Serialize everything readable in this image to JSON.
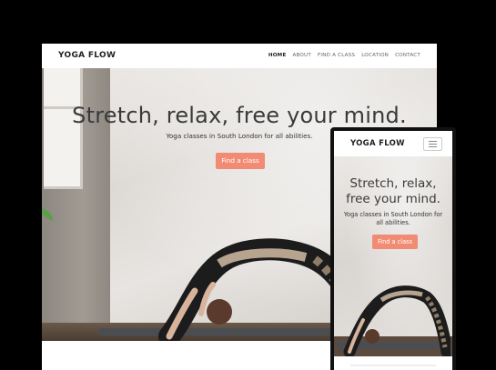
{
  "desktop": {
    "brand": "YOGA FLOW",
    "nav": [
      "HOME",
      "ABOUT",
      "FIND A CLASS",
      "LOCATION",
      "CONTACT"
    ],
    "active_nav": "HOME",
    "hero": {
      "title": "Stretch, relax, free your mind.",
      "subtitle": "Yoga classes in South London for all abilities.",
      "cta": "Find a class"
    }
  },
  "mobile": {
    "brand": "YOGA FLOW",
    "menu_icon": "hamburger-menu-icon",
    "hero": {
      "title_line1": "Stretch, relax,",
      "title_line2": "free your mind.",
      "subtitle": "Yoga classes in South London for all abilities.",
      "cta": "Find a class"
    }
  },
  "colors": {
    "cta": "#f28b73",
    "text_dark": "#222222",
    "background": "#000000"
  }
}
